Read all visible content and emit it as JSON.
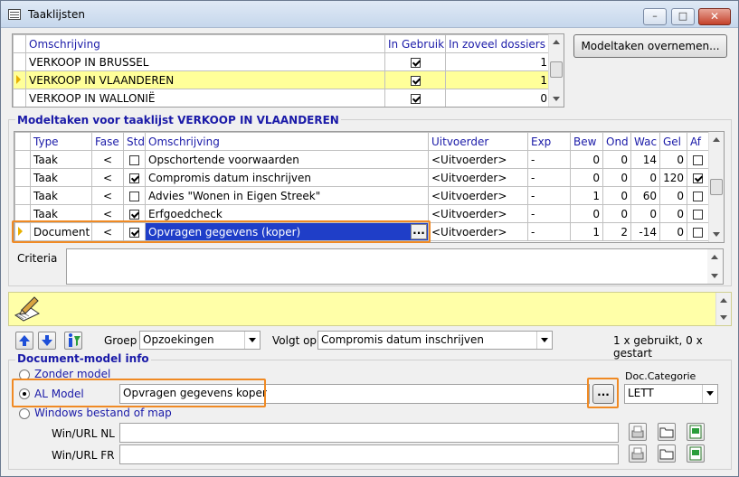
{
  "window": {
    "title": "Taaklijsten"
  },
  "top_grid": {
    "columns": [
      "Omschrijving",
      "In Gebruik",
      "In zoveel dossiers"
    ],
    "rows": [
      {
        "name": "VERKOOP IN BRUSSEL",
        "in_use": true,
        "count": "1"
      },
      {
        "name": "VERKOOP IN VLAANDEREN",
        "in_use": true,
        "count": "1"
      },
      {
        "name": "VERKOOP IN WALLONIË",
        "in_use": true,
        "count": "0"
      }
    ]
  },
  "buttons": {
    "modeltaken": "Modeltaken overnemen..."
  },
  "modeltaken": {
    "section_title": "Modeltaken voor taaklijst VERKOOP IN VLAANDEREN",
    "columns": [
      "Type",
      "Fase",
      "Std",
      "Omschrijving",
      "Uitvoerder",
      "Exp",
      "Bew",
      "Ond",
      "Wac",
      "Gel",
      "Af"
    ],
    "rows": [
      {
        "type": "Taak",
        "fase": "<",
        "std": false,
        "desc": "Opschortende voorwaarden",
        "uitv": "<Uitvoerder>",
        "exp": "-",
        "bew": "0",
        "ond": "0",
        "wac": "14",
        "gel": "0",
        "af": false
      },
      {
        "type": "Taak",
        "fase": "<",
        "std": true,
        "desc": "Compromis datum inschrijven",
        "uitv": "<Uitvoerder>",
        "exp": "-",
        "bew": "0",
        "ond": "0",
        "wac": "0",
        "gel": "120",
        "af": true
      },
      {
        "type": "Taak",
        "fase": "<",
        "std": false,
        "desc": "Advies \"Wonen in Eigen Streek\"",
        "uitv": "<Uitvoerder>",
        "exp": "-",
        "bew": "1",
        "ond": "0",
        "wac": "60",
        "gel": "0",
        "af": false
      },
      {
        "type": "Taak",
        "fase": "<",
        "std": true,
        "desc": "Erfgoedcheck",
        "uitv": "<Uitvoerder>",
        "exp": "-",
        "bew": "0",
        "ond": "0",
        "wac": "0",
        "gel": "0",
        "af": false
      },
      {
        "type": "Document",
        "fase": "<",
        "std": true,
        "desc": "Opvragen gegevens (koper)",
        "uitv": "<Uitvoerder>",
        "exp": "-",
        "bew": "1",
        "ond": "2",
        "wac": "-14",
        "gel": "0",
        "af": false
      }
    ],
    "ellipsis": "..."
  },
  "criteria": {
    "label": "Criteria"
  },
  "toolbar": {
    "groep_label": "Groep",
    "groep_value": "Opzoekingen",
    "volgt_label": "Volgt op",
    "volgt_value": "Compromis datum inschrijven",
    "usage": "1 x gebruikt, 0 x gestart"
  },
  "docmodel": {
    "section_title": "Document-model info",
    "options": {
      "zonder": "Zonder model",
      "al": "AL Model",
      "windows": "Windows bestand of map"
    },
    "al_value": "Opvragen gegevens koper",
    "ellipsis": "...",
    "category_label": "Doc.Categorie",
    "category_value": "LETT",
    "url_nl_label": "Win/URL NL",
    "url_fr_label": "Win/URL FR"
  },
  "colors": {
    "selected_row": "#ffff99",
    "highlight": "#f08a24",
    "header_text": "#1a1aa8"
  }
}
